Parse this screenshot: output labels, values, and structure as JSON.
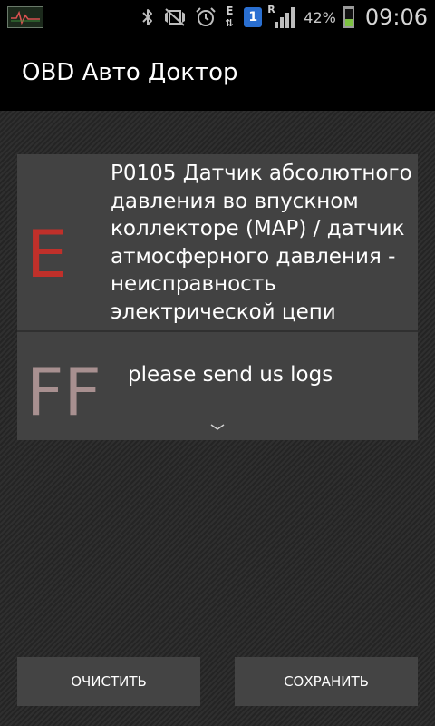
{
  "status_bar": {
    "network_letter": "E",
    "network_arrows": "⇅",
    "sim_slot": "1",
    "roaming_letter": "R",
    "battery_percent": "42%",
    "battery_level": 0.42,
    "time": "09:06"
  },
  "action_bar": {
    "title": "OBD Авто Доктор"
  },
  "errors": [
    {
      "code_letter": "E",
      "text": "P0105 Датчик абсолютного давления во впускном коллекторе (MAP) / датчик атмосферного давления - неисправность электрической цепи"
    },
    {
      "code_letter": "FF",
      "text": "please send us logs"
    }
  ],
  "buttons": {
    "clear_label": "ОЧИСТИТЬ",
    "save_label": "СОХРАНИТЬ"
  },
  "colors": {
    "error_letter": "#c0302a",
    "freeze_frame_letter": "#a89090",
    "battery_fill": "#7dc242",
    "sim_badge": "#2a6fd1"
  }
}
